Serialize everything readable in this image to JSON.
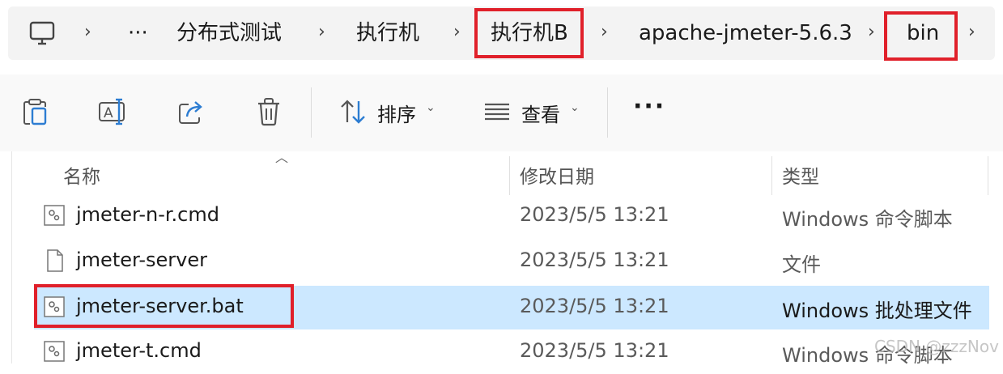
{
  "breadcrumb": {
    "items": [
      "分布式测试",
      "执行机",
      "执行机B",
      "apache-jmeter-5.6.3",
      "bin"
    ],
    "overflow": "···"
  },
  "toolbar": {
    "sort_label": "排序",
    "view_label": "查看",
    "more_label": "···"
  },
  "columns": {
    "name": "名称",
    "date": "修改日期",
    "type": "类型"
  },
  "files": [
    {
      "name": "jmeter-n-r.cmd",
      "date": "2023/5/5 13:21",
      "type": "Windows 命令脚本",
      "icon": "cmd-file-icon"
    },
    {
      "name": "jmeter-server",
      "date": "2023/5/5 13:21",
      "type": "文件",
      "icon": "blank-file-icon"
    },
    {
      "name": "jmeter-server.bat",
      "date": "2023/5/5 13:21",
      "type": "Windows 批处理文件",
      "icon": "bat-file-icon",
      "selected": true
    },
    {
      "name": "jmeter-t.cmd",
      "date": "2023/5/5 13:21",
      "type": "Windows 命令脚本",
      "icon": "cmd-file-icon"
    }
  ],
  "watermark": "CSDN @zzzNov",
  "colors": {
    "highlight": "#e0202a",
    "selection": "#cce8ff"
  }
}
